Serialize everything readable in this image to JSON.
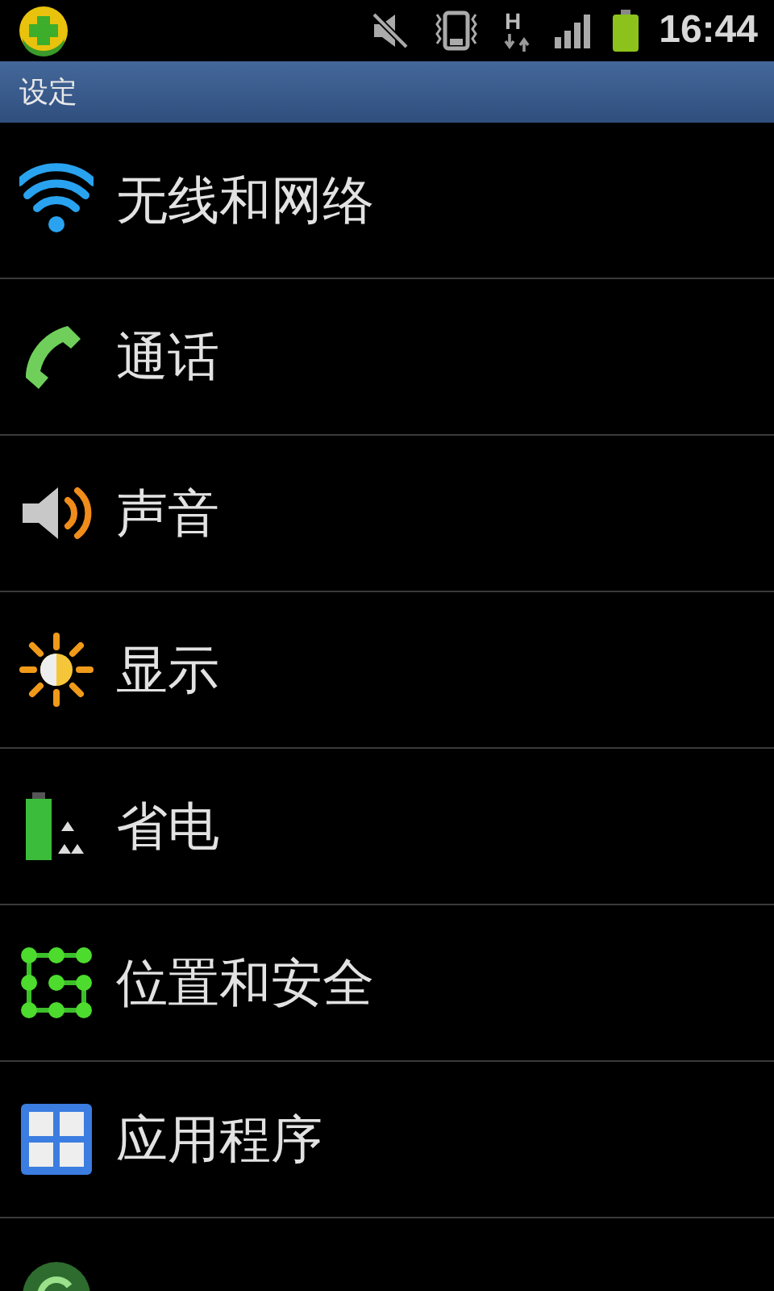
{
  "status_bar": {
    "network": "H",
    "time": "16:44"
  },
  "title_bar": {
    "title": "设定"
  },
  "settings": [
    {
      "label": "无线和网络",
      "kind": "wifi"
    },
    {
      "label": "通话",
      "kind": "phone"
    },
    {
      "label": "声音",
      "kind": "sound"
    },
    {
      "label": "显示",
      "kind": "display"
    },
    {
      "label": "省电",
      "kind": "power"
    },
    {
      "label": "位置和安全",
      "kind": "security"
    },
    {
      "label": "应用程序",
      "kind": "apps"
    },
    {
      "kind": "sync"
    }
  ]
}
